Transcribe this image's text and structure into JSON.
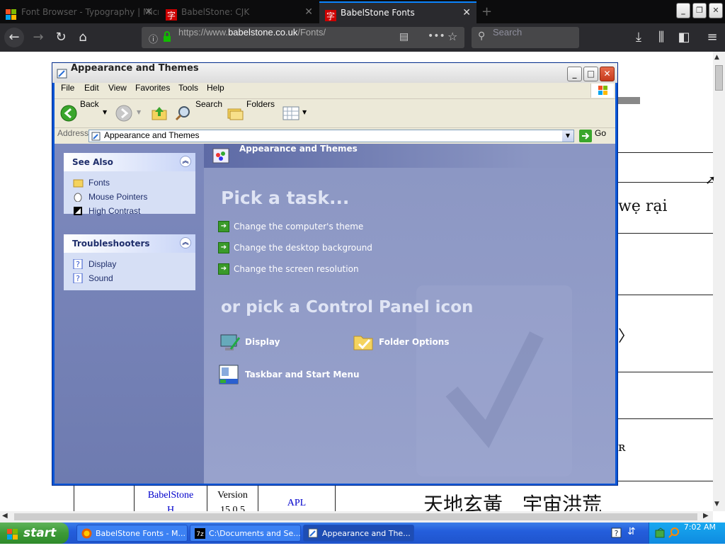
{
  "browser": {
    "tabs": [
      {
        "label": "Font Browser - Typography | Micro",
        "active": false
      },
      {
        "label": "BabelStone: CJK",
        "active": false
      },
      {
        "label": "BabelStone Fonts",
        "active": true
      }
    ],
    "url_prefix": "https://www.",
    "url_domain": "babelstone.co.uk",
    "url_path": "/Fonts/",
    "search_placeholder": "Search"
  },
  "page": {
    "fragment_1": "wẹ rại",
    "fragment_2": "〉",
    "fragment_3": "ʀ",
    "table": {
      "c1": "BabelStone",
      "c1b": "H",
      "c2": "Version",
      "c2b": "15.0.5",
      "c3": "APL",
      "c4": "天地玄黃　宇宙洪荒"
    }
  },
  "explorer": {
    "title": "Appearance and Themes",
    "menu": [
      "File",
      "Edit",
      "View",
      "Favorites",
      "Tools",
      "Help"
    ],
    "toolbar": {
      "back": "Back",
      "search": "Search",
      "folders": "Folders"
    },
    "address_label": "Address",
    "address_value": "Appearance and Themes",
    "go_label": "Go",
    "see_also": {
      "title": "See Also",
      "items": [
        "Fonts",
        "Mouse Pointers",
        "High Contrast"
      ]
    },
    "troubleshooters": {
      "title": "Troubleshooters",
      "items": [
        "Display",
        "Sound"
      ]
    },
    "main_title": "Appearance and Themes",
    "pick_task": "Pick a task...",
    "tasks": [
      "Change the computer's theme",
      "Change the desktop background",
      "Change the screen resolution"
    ],
    "pick_icon": "or pick a Control Panel icon",
    "icons": [
      "Display",
      "Folder Options",
      "Taskbar and Start Menu"
    ]
  },
  "taskbar": {
    "start": "start",
    "tasks": [
      "BabelStone Fonts - M...",
      "C:\\Documents and Se...",
      "Appearance and The..."
    ],
    "clock": "7:02 AM"
  }
}
